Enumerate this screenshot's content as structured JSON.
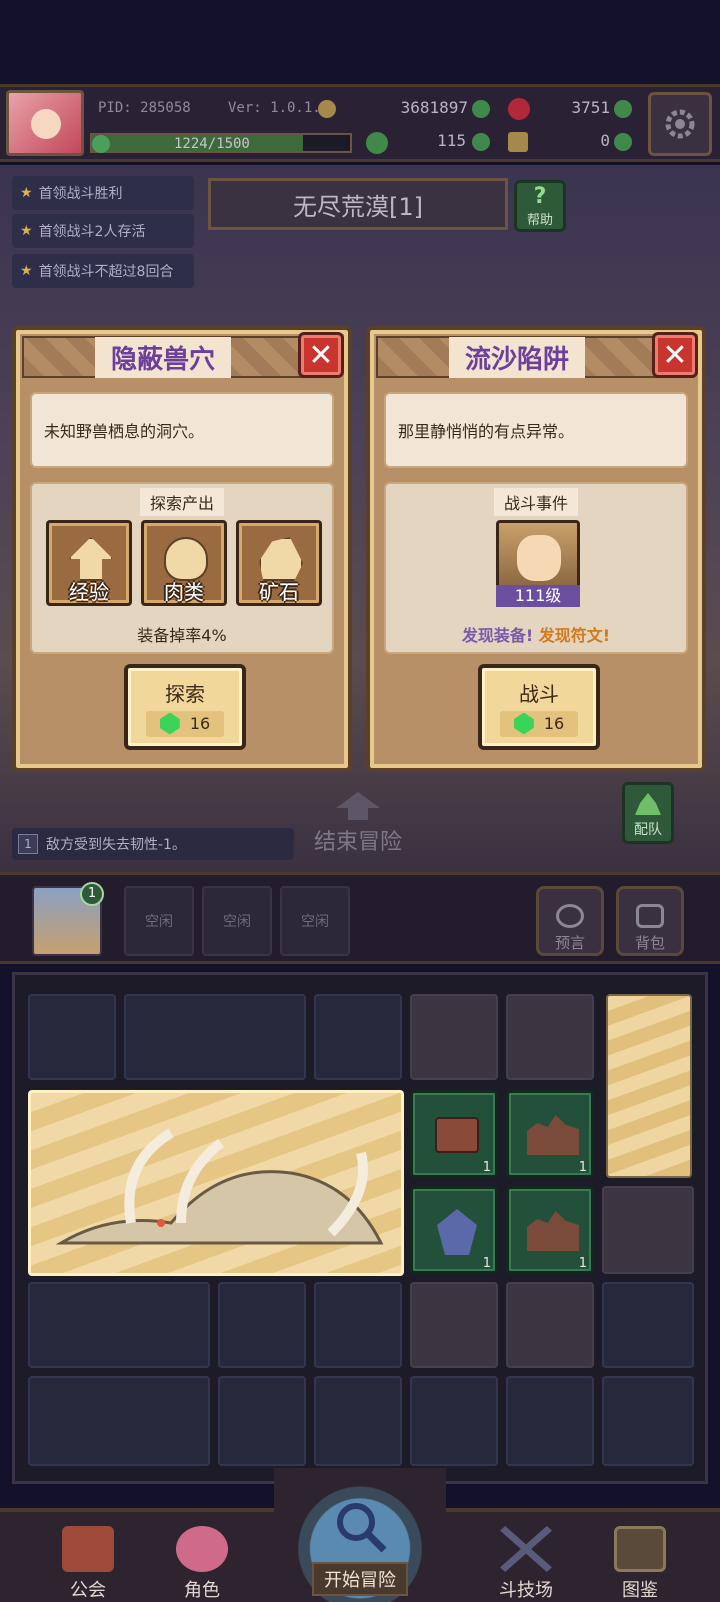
{
  "header": {
    "pid": "PID: 285058",
    "version": "Ver: 1.0.1.0",
    "gold": "3681897",
    "gems": "3751",
    "clover": "115",
    "item_count": "0",
    "xp": "1224/1500",
    "xp_progress": 0.816
  },
  "quests": [
    {
      "label": "首领战斗胜利"
    },
    {
      "label": "首领战斗2人存活"
    },
    {
      "label": "首领战斗不超过8回合"
    }
  ],
  "area": {
    "title": "无尽荒漠[1]",
    "help_label": "帮助"
  },
  "cards": [
    {
      "title": "隐蔽兽穴",
      "close": "✕",
      "description": "未知野兽栖息的洞穴。",
      "section_label": "探索产出",
      "loot": [
        {
          "label": "经验",
          "icon": "experience-arrow-icon"
        },
        {
          "label": "肉类",
          "icon": "meat-icon"
        },
        {
          "label": "矿石",
          "icon": "ore-icon"
        }
      ],
      "footer": "装备掉率4%",
      "action_label": "探索",
      "cost": "16"
    },
    {
      "title": "流沙陷阱",
      "close": "✕",
      "description": "那里静悄悄的有点异常。",
      "section_label": "战斗事件",
      "enemy_level": "111级",
      "found_equipment": "发现装备!",
      "found_rune": "发现符文!",
      "action_label": "战斗",
      "cost": "16"
    }
  ],
  "middle": {
    "end_adventure": "结束冒险",
    "team_label": "配队",
    "tip_number": "1",
    "tip_text": "敌方受到失去韧性-1。"
  },
  "party": {
    "first_badge": "1",
    "idle": [
      "空闲",
      "空闲",
      "空闲"
    ],
    "prophecy_label": "预言",
    "backpack_label": "背包"
  },
  "grid": {
    "counts": [
      "1",
      "1",
      "1",
      "1"
    ]
  },
  "nav": {
    "guild": "公会",
    "character": "角色",
    "start_adventure": "开始冒险",
    "arena": "斗技场",
    "codex": "图鉴"
  },
  "colors": {
    "title_purple": "#6c3f9c",
    "equipment_purple": "#7a5aa8",
    "rune_orange": "#d07a1c",
    "gem_green": "#3bd45a",
    "close_red": "#c9342f"
  }
}
